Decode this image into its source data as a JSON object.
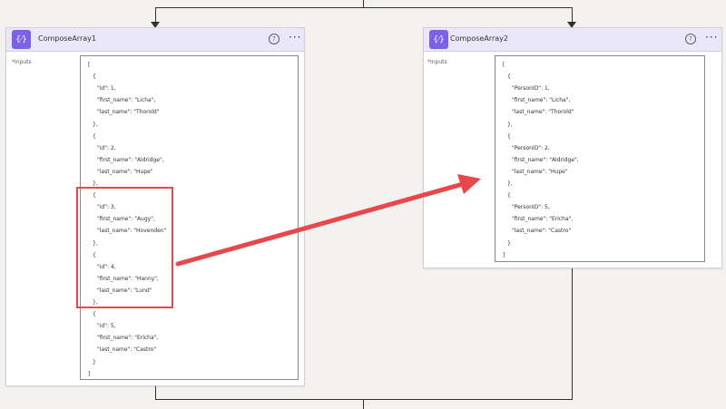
{
  "cards": [
    {
      "title": "ComposeArray1",
      "icon": "compose-icon",
      "icon_glyph": "{⁄}",
      "help_glyph": "?",
      "more_glyph": "···",
      "inputs_label": "*Inputs",
      "lines": [
        "[",
        "{",
        "\"id\": 1,",
        "\"first_name\": \"Licha\",",
        "\"last_name\": \"Thorold\"",
        "},",
        "{",
        "\"id\": 2,",
        "\"first_name\": \"Aldridge\",",
        "\"last_name\": \"Hupe\"",
        "},",
        "{",
        "\"id\": 3,",
        "\"first_name\": \"Augy\",",
        "\"last_name\": \"Hovenden\"",
        "},",
        "{",
        "\"id\": 4,",
        "\"first_name\": \"Hanny\",",
        "\"last_name\": \"Lund\"",
        "},",
        "{",
        "\"id\": 5,",
        "\"first_name\": \"Ericha\",",
        "\"last_name\": \"Castro\"",
        "}",
        "]"
      ]
    },
    {
      "title": "ComposeArray2",
      "icon": "compose-icon",
      "icon_glyph": "{⁄}",
      "help_glyph": "?",
      "more_glyph": "···",
      "inputs_label": "*Inputs",
      "lines": [
        "[",
        "{",
        "\"PersonID\": 1,",
        "\"first_name\": \"Licha\",",
        "\"last_name\": \"Thorold\"",
        "},",
        "{",
        "\"PersonID\": 2,",
        "\"first_name\": \"Aldridge\",",
        "\"last_name\": \"Hupe\"",
        "},",
        "{",
        "\"PersonID\": 5,",
        "\"first_name\": \"Ericha\",",
        "\"last_name\": \"Castro\"",
        "}",
        "]"
      ]
    }
  ],
  "colors": {
    "accent": "#7b61e6",
    "header_bg": "#ebe7fb",
    "highlight": "#e8474b",
    "connector": "#323130"
  }
}
